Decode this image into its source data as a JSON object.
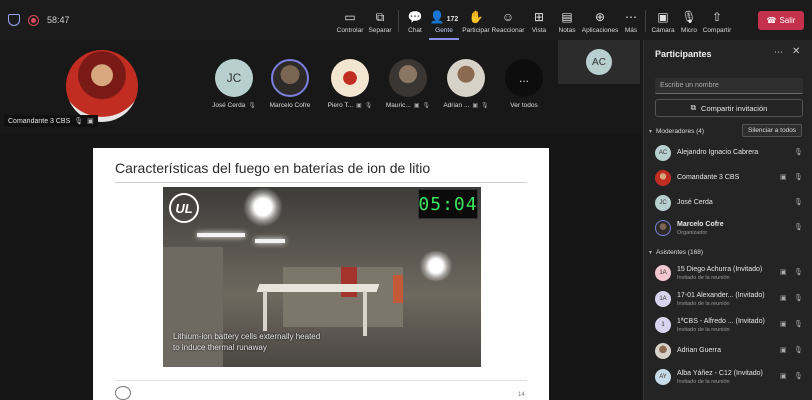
{
  "topbar": {
    "timer": "58:47",
    "buttons": [
      {
        "label": "Controlar",
        "icon": "control-icon"
      },
      {
        "label": "Separar",
        "icon": "popout-icon"
      },
      {
        "label": "Chat",
        "icon": "chat-icon"
      },
      {
        "label": "Gente",
        "icon": "people-icon",
        "count": "172",
        "active": true
      },
      {
        "label": "Participar",
        "icon": "raise-hand-icon"
      },
      {
        "label": "Reaccionar",
        "icon": "emoji-icon"
      },
      {
        "label": "Vista",
        "icon": "grid-icon"
      },
      {
        "label": "Notas",
        "icon": "notes-icon"
      },
      {
        "label": "Aplicaciones",
        "icon": "add-apps-icon"
      },
      {
        "label": "Más",
        "icon": "more-icon"
      },
      {
        "label": "Cámara",
        "icon": "camera-off-icon"
      },
      {
        "label": "Micro",
        "icon": "mic-off-icon"
      },
      {
        "label": "Compartir",
        "icon": "share-icon"
      }
    ],
    "leave_label": "Salir"
  },
  "strip": {
    "presenter_name": "Comandante 3 CBS",
    "tiles": [
      {
        "initials": "JC",
        "name": "José Cerda",
        "color": "#b8cfd0"
      },
      {
        "initials": "",
        "name": "Marcelo Cofre",
        "color": "#5a4a3c"
      },
      {
        "initials": "",
        "name": "Piero T...",
        "color": "#f2e6d0"
      },
      {
        "initials": "",
        "name": "Mauric...",
        "color": "#6b5c4d"
      },
      {
        "initials": "",
        "name": "Adrian ...",
        "color": "#d7d2c8"
      },
      {
        "initials": "...",
        "name": "Ver todos",
        "color": "#0d0d0d"
      }
    ],
    "extra_tile_initials": "AC"
  },
  "slide": {
    "title": "Características del fuego en baterías de ion de litio",
    "video": {
      "logo": "UL",
      "clock": "05:04",
      "caption": "Lithium-ion battery cells externally heated to induce thermal runaway"
    },
    "page_number": "14"
  },
  "panel": {
    "title": "Participantes",
    "search_placeholder": "Escribe un nombre",
    "share_invite_label": "Compartir invitación",
    "moderators_label": "Moderadores (4)",
    "mute_all_label": "Silenciar a todos",
    "moderators": [
      {
        "initials": "AC",
        "name": "Alejandro Ignacio Cabrera",
        "role": "",
        "color": "#b8cfd0"
      },
      {
        "initials": "",
        "name": "Comandante 3 CBS",
        "role": "",
        "color": "#c22d22"
      },
      {
        "initials": "JC",
        "name": "José Cerda",
        "role": "",
        "color": "#b8cfd0"
      },
      {
        "initials": "",
        "name": "Marcelo Cofre",
        "role": "Organizador",
        "color": "#5a4a3c"
      }
    ],
    "attendees_label": "Asistentes (168)",
    "attendees": [
      {
        "initials": "1A",
        "name": "15 Diego Achurra (Invitado)",
        "role": "Invitado de la reunión",
        "color": "#f3c7d0"
      },
      {
        "initials": "1A",
        "name": "17-01 Alexander... (Invitado)",
        "role": "Invitado de la reunión",
        "color": "#d8d4f0"
      },
      {
        "initials": "1",
        "name": "1ªCBS - Alfredo ... (Invitado)",
        "role": "Invitado de la reunión",
        "color": "#d8d4f0"
      },
      {
        "initials": "",
        "name": "Adrian Guerra",
        "role": "",
        "color": "#8b6a52"
      },
      {
        "initials": "AY",
        "name": "Alba Yáñez - C12 (Invitado)",
        "role": "Invitado de la reunión",
        "color": "#c8dbe8"
      }
    ]
  }
}
